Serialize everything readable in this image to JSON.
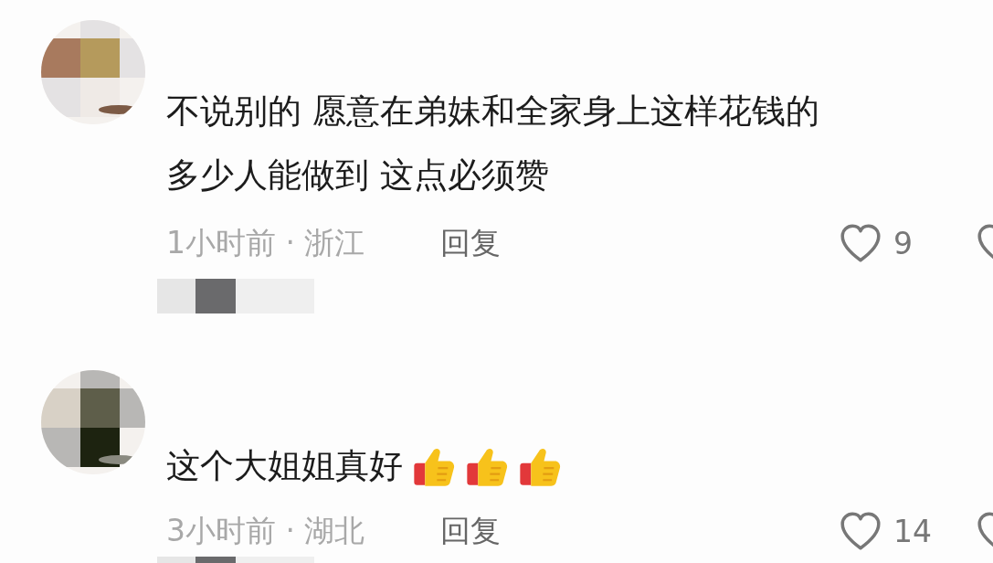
{
  "comments": [
    {
      "text": "不说别的 愿意在弟妹和全家身上这样花钱的",
      "text_line_2": "多少人能做到 这点必须赞",
      "time_location": "1小时前 · 浙江",
      "reply": "回复",
      "likes": "9"
    },
    {
      "text": "这个大姐姐真好",
      "emojis": [
        {
          "kind": "thumbs_up"
        },
        {
          "kind": "thumbs_up"
        },
        {
          "kind": "thumbs_up"
        }
      ],
      "time_location": "3小时前 · 湖北",
      "reply": "回复",
      "likes": "14"
    }
  ]
}
